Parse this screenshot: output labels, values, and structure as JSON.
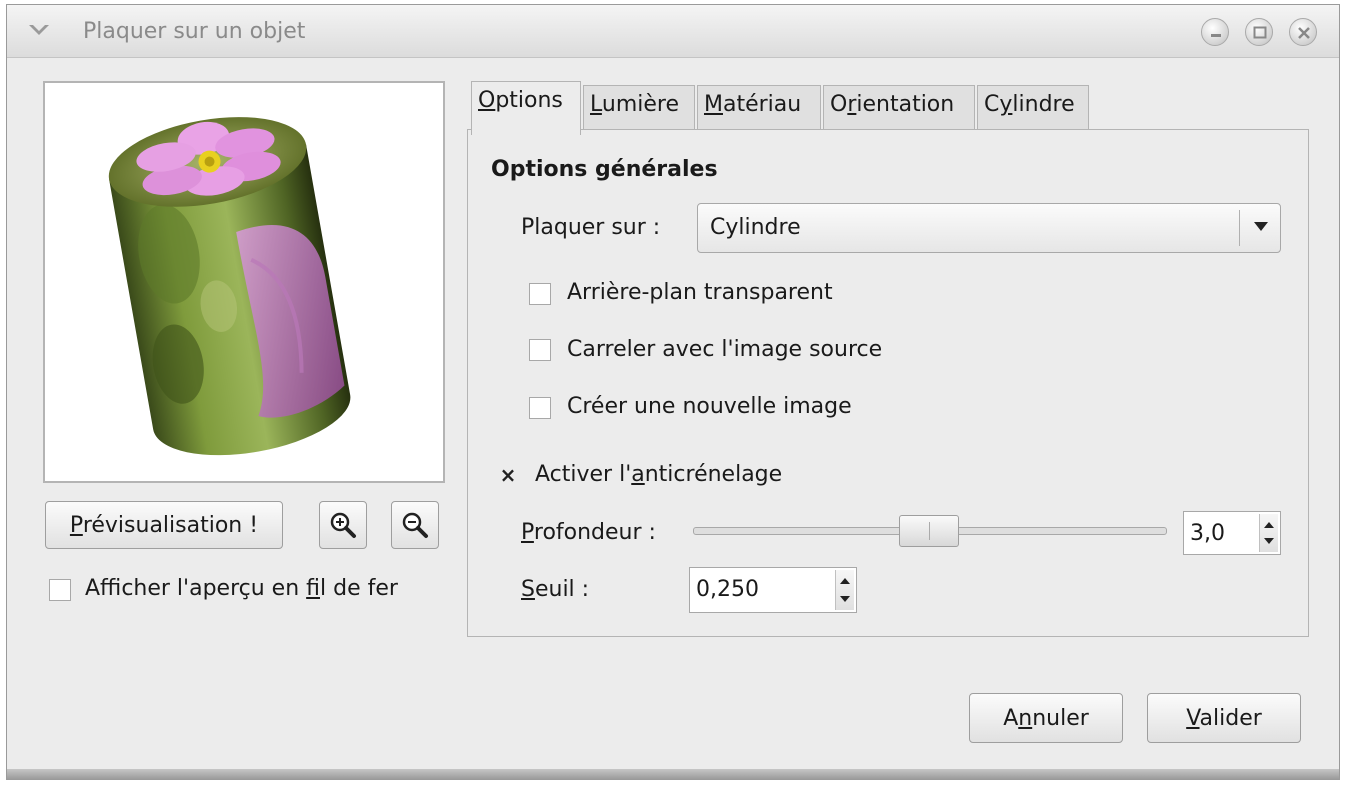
{
  "window": {
    "title": "Plaquer sur un objet",
    "controls": [
      "minimize-icon",
      "maximize-icon",
      "close-icon"
    ]
  },
  "left": {
    "preview_button": {
      "pre": "",
      "mnemonic": "P",
      "post": "révisualisation !"
    },
    "zoom_in_icon": "zoom-in-icon",
    "zoom_out_icon": "zoom-out-icon",
    "wireframe_checkbox": {
      "pre": "Afficher l'aperçu en ",
      "mnemonic": "f",
      "post": "il de fer",
      "checked": false
    }
  },
  "tabs": [
    {
      "pre": "",
      "mnemonic": "O",
      "post": "ptions",
      "active": true
    },
    {
      "pre": "",
      "mnemonic": "L",
      "post": "umière",
      "active": false
    },
    {
      "pre": "",
      "mnemonic": "M",
      "post": "atériau",
      "active": false
    },
    {
      "pre": "O",
      "mnemonic": "r",
      "post": "ientation",
      "active": false
    },
    {
      "pre": "C",
      "mnemonic": "y",
      "post": "lindre",
      "active": false
    }
  ],
  "options": {
    "section_title": "Options générales",
    "map_label": "Plaquer sur :",
    "map_value": "Cylindre",
    "checkboxes": [
      {
        "label": "Arrière-plan transparent",
        "checked": false
      },
      {
        "label": "Carreler avec l'image source",
        "checked": false
      },
      {
        "label": "Créer une nouvelle image",
        "checked": false
      }
    ],
    "antialias": {
      "pre": "Activer l'",
      "mnemonic": "a",
      "post": "nticrénelage",
      "checked": true,
      "mark": "×"
    },
    "depth": {
      "pre": "",
      "mnemonic": "P",
      "post": "rofondeur :",
      "value": "3,0",
      "slider_fraction": 0.5
    },
    "threshold": {
      "pre": "",
      "mnemonic": "S",
      "post": "euil :",
      "value": "0,250"
    }
  },
  "buttons": {
    "cancel": {
      "pre": "A",
      "mnemonic": "n",
      "post": "nuler"
    },
    "ok": {
      "pre": "",
      "mnemonic": "V",
      "post": "alider"
    }
  }
}
